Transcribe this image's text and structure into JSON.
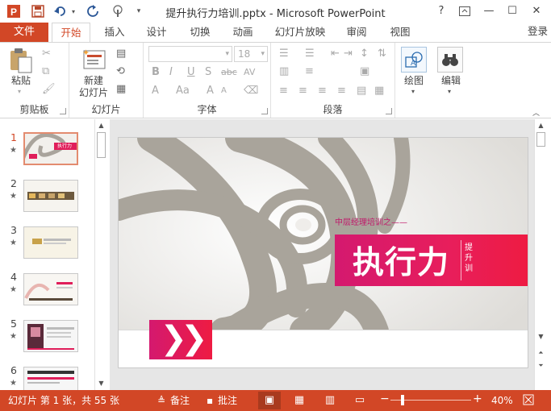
{
  "app": {
    "title": "提升执行力培训.pptx - Microsoft PowerPoint",
    "window_controls": {
      "help": "?",
      "options": "⧉",
      "minimize": "—",
      "maximize": "☐",
      "close": "✕"
    }
  },
  "qat": {
    "icons": [
      "powerpoint-logo-icon",
      "save-icon",
      "undo-icon",
      "redo-icon",
      "touch-mode-icon",
      "customize-qat-icon"
    ],
    "logo_letter": "P"
  },
  "tabs": {
    "file": "文件",
    "items": [
      "开始",
      "插入",
      "设计",
      "切换",
      "动画",
      "幻灯片放映",
      "审阅",
      "视图"
    ],
    "active": "开始",
    "login": "登录"
  },
  "ribbon": {
    "clipboard": {
      "paste": "粘贴",
      "label": "剪贴板"
    },
    "slides": {
      "new_slide_line1": "新建",
      "new_slide_line2": "幻灯片",
      "label": "幻灯片"
    },
    "font": {
      "font_size": "18",
      "bold": "B",
      "italic": "I",
      "underline": "U",
      "shadow": "S",
      "strike": "abc",
      "spacing": "AV",
      "color": "A",
      "case": "Aa",
      "grow": "A",
      "shrink": "A",
      "label": "字体"
    },
    "paragraph": {
      "label": "段落"
    },
    "drawing": {
      "label": "绘图"
    },
    "editing": {
      "label": "编辑"
    }
  },
  "thumbnails": [
    {
      "num": "1",
      "star": "★",
      "selected": true
    },
    {
      "num": "2",
      "star": "★",
      "selected": false
    },
    {
      "num": "3",
      "star": "★",
      "selected": false
    },
    {
      "num": "4",
      "star": "★",
      "selected": false
    },
    {
      "num": "5",
      "star": "★",
      "selected": false
    },
    {
      "num": "6",
      "star": "★",
      "selected": false
    }
  ],
  "thumb1_text": "执行力",
  "slide": {
    "subtitle": "中层经理培训之——",
    "title": "执行力",
    "side_text": "提升训",
    "arrow": "❯❯",
    "colors": {
      "accent_start": "#d4196f",
      "accent_end": "#ee1b42"
    }
  },
  "status": {
    "slide_info": "幻灯片 第 1 张，共 55 张",
    "notes": "备注",
    "comments": "批注",
    "zoom": "40%",
    "zoom_minus": "−",
    "zoom_plus": "+",
    "brand_color": "#d24726"
  }
}
